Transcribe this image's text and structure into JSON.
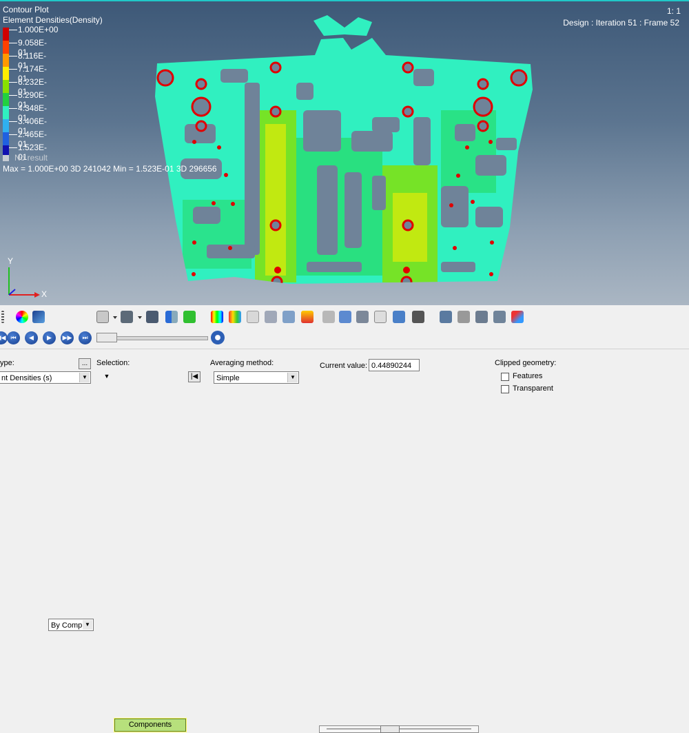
{
  "viewport": {
    "plot_title": "Contour Plot",
    "result_name": "Element Densities(Density)",
    "scale": "1: 1",
    "frame_info": "Design : Iteration 51 : Frame 52",
    "legend": {
      "entries": [
        {
          "value": "1.000E+00",
          "color": "#d00000"
        },
        {
          "value": "9.058E-01",
          "color": "#ff4000"
        },
        {
          "value": "8.116E-01",
          "color": "#ff9900"
        },
        {
          "value": "7.174E-01",
          "color": "#ffee00"
        },
        {
          "value": "6.232E-01",
          "color": "#88e000"
        },
        {
          "value": "5.290E-01",
          "color": "#22d040"
        },
        {
          "value": "4.348E-01",
          "color": "#30f0c0"
        },
        {
          "value": "3.406E-01",
          "color": "#30b0f0"
        },
        {
          "value": "2.465E-01",
          "color": "#2060e0"
        },
        {
          "value": "1.523E-01",
          "color": "#1010b0"
        }
      ],
      "no_result": "No result"
    },
    "stats": {
      "max": "Max = 1.000E+00",
      "max_elem": "3D 241042",
      "min": "Min = 1.523E-01",
      "min_elem": "3D 296656"
    },
    "axis_y": "Y",
    "axis_x": "X"
  },
  "toolbar": {
    "color_mode": "By Comp",
    "icons": [
      "contour-icon",
      "deformed-icon",
      "mode-icon",
      "cube-icon",
      "cube-dark-icon",
      "component-icon",
      "mirror-icon",
      "green-box-icon",
      "legend-icon",
      "vector-icon",
      "section-icon",
      "box-section-icon",
      "measure-icon",
      "query-icon",
      "hotspot-icon",
      "tensor-icon",
      "curve-icon",
      "table-icon",
      "note-icon",
      "tracking-icon",
      "transform-icon",
      "clip-icon",
      "comment-icon",
      "grid-icon",
      "stack-icon",
      "plot-icon"
    ]
  },
  "animation": {
    "buttons": [
      "first-frame",
      "previous-frame",
      "play",
      "next-frame",
      "last-frame"
    ],
    "settings_icon": "gear-icon"
  },
  "panel": {
    "result_type_label": "ype:",
    "result_type_value": "nt Densities (s)",
    "browse_label": "...",
    "selection_label": "Selection:",
    "selection_button": "Components",
    "averaging_label": "Averaging method:",
    "averaging_value": "Simple",
    "current_value_label": "Current value:",
    "current_value": "0.44890244",
    "current_value_fraction": 0.4489,
    "clipped_label": "Clipped geometry:",
    "features_label": "Features",
    "transparent_label": "Transparent"
  }
}
